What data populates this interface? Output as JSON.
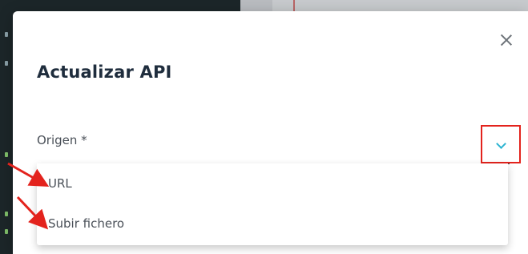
{
  "dialog": {
    "title": "Actualizar API",
    "close_icon": "close-icon"
  },
  "field": {
    "label": "Origen *",
    "chevron_icon": "chevron-down-icon"
  },
  "dropdown": {
    "options": [
      "URL",
      "Subir fichero"
    ]
  },
  "colors": {
    "accent": "#2bb3d1",
    "annotation": "#e3231d",
    "text": "#1f2d3d"
  }
}
